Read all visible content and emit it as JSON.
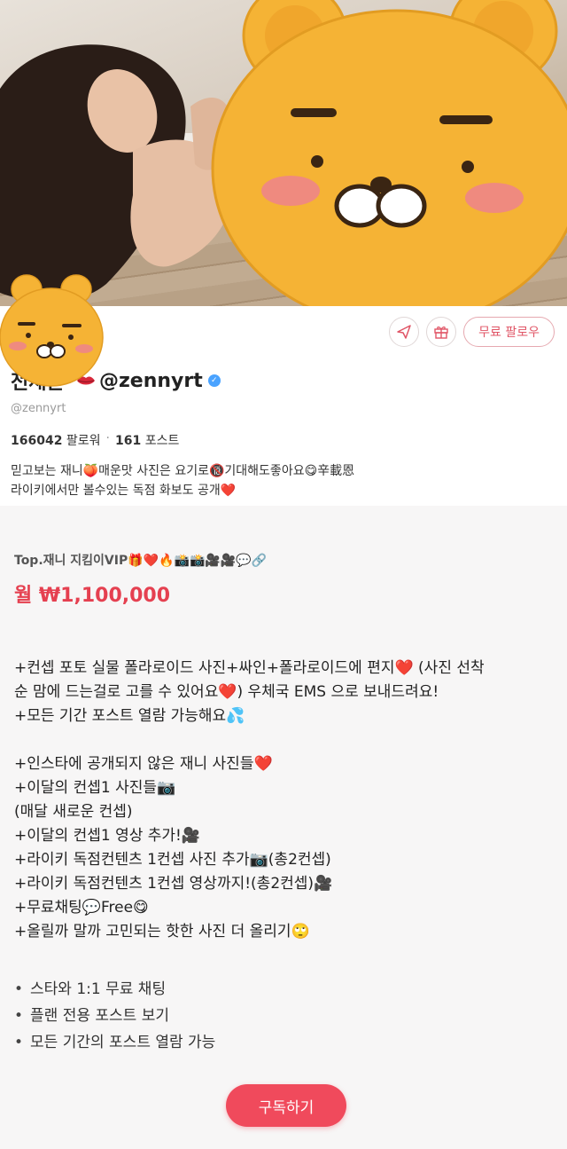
{
  "profile": {
    "display_name": "전재은",
    "handle_main": "@zennyrt",
    "handle_sub": "@zennyrt",
    "followers_count": "166042",
    "followers_label": "팔로워",
    "posts_count": "161",
    "posts_label": "포스트",
    "bio_line1": "믿고보는 재니🍑매운맛 사진은 요기로🔞기대해도좋아요😋辛載恩",
    "bio_line2": "라이키에서만 볼수있는 독점 화보도 공개❤️",
    "follow_label": "무료 팔로우",
    "icons": [
      "send-icon",
      "gift-icon",
      "verified-icon",
      "lips-icon"
    ]
  },
  "plan": {
    "name": "Top.재니 지킴이VIP🎁❤️🔥📸📸🎥🎥💬🔗",
    "price": "월 ₩1,100,000",
    "description": [
      "+컨셉 포토 실물 폴라로이드 사진+싸인+폴라로이드에 편지❤️ (사진 선착",
      "순 맘에 드는걸로 고를 수 있어요❤️) 우체국 EMS 으로 보내드려요!",
      "+모든 기간 포스트 열람 가능해요💦",
      "",
      "+인스타에 공개되지 않은 재니 사진들❤️",
      "+이달의 컨셉1 사진들📷",
      "(매달 새로운 컨셉)",
      "+이달의 컨셉1 영상 추가!🎥",
      "+라이키 독점컨텐츠 1컨셉 사진 추가📷(총2컨셉)",
      "+라이키 독점컨텐츠 1컨셉 영상까지!(총2컨셉)🎥",
      "+무료채팅💬Free😋",
      "+올릴까 말까 고민되는 핫한 사진 더 올리기🙄"
    ],
    "benefits": [
      "스타와 1:1 무료 채팅",
      "플랜 전용 포스트 보기",
      "모든 기간의 포스트 열람 가능"
    ],
    "subscribe_label": "구독하기"
  },
  "colors": {
    "accent": "#f04a5c",
    "price": "#e54050",
    "mascot": "#f5b335",
    "verified": "#4aa3ff"
  }
}
